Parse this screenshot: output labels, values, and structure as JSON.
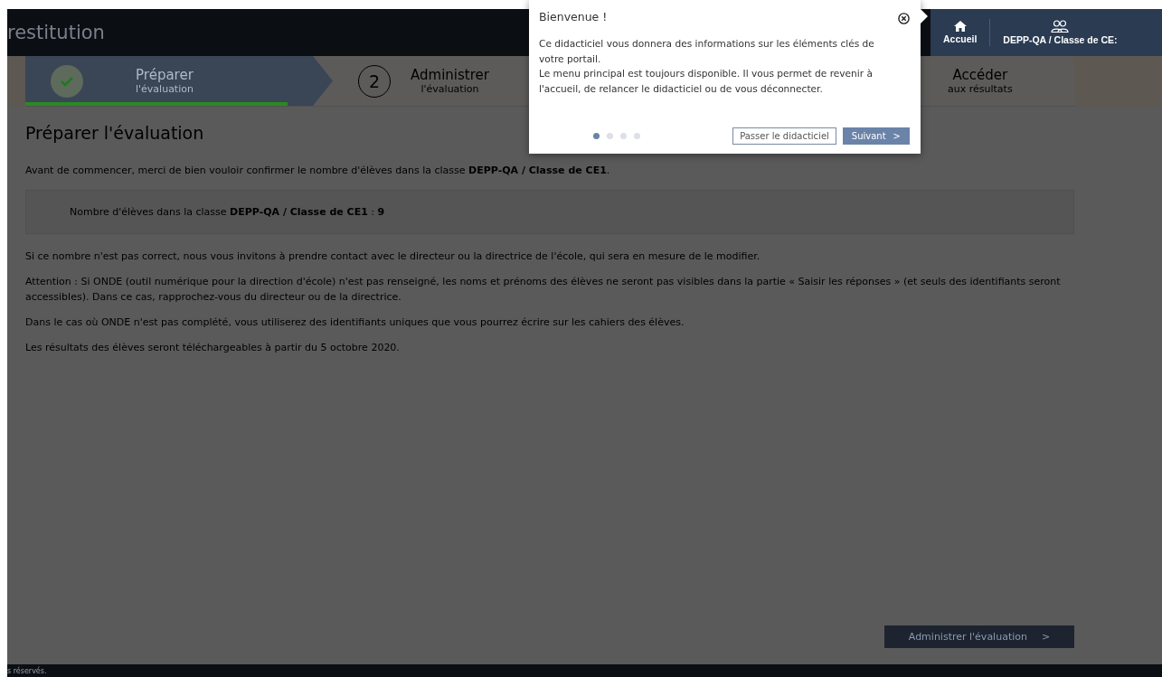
{
  "header": {
    "title": "restitution"
  },
  "nav": {
    "items": [
      {
        "kind": "home",
        "label": "Accueil"
      },
      {
        "kind": "class",
        "label": "DEPP-QA / Classe de CE:"
      }
    ]
  },
  "steps": [
    {
      "kind": "done",
      "title": "Préparer",
      "subtitle": "l'évaluation",
      "selected": true
    },
    {
      "kind": "number",
      "number": "2",
      "title": "Administrer",
      "subtitle": "l'évaluation",
      "selected": false
    },
    {
      "kind": "covered",
      "title": "Accéder",
      "subtitle": "aux résultats",
      "selected": false
    }
  ],
  "page": {
    "title": "Préparer l'évaluation",
    "intro": "Avant de commencer, merci de bien vouloir confirmer le nombre d'élèves dans la classe **DEPP-QA / Classe de CE1**.",
    "count_box": "Nombre d'élèves dans la classe **DEPP-QA / Classe de CE1** : **9**",
    "paragraphs": [
      "Si ce nombre n'est pas correct, nous vous invitons à prendre contact avec le directeur ou la directrice de l'école, qui sera en mesure de le modifier.",
      "Attention : Si ONDE (outil numérique pour la direction d'école) n'est pas renseigné, les noms et prénoms des élèves ne seront pas visibles dans la partie « Saisir les réponses » (et seuls des identifiants seront accessibles). Dans ce cas, rapprochez-vous du directeur ou de la directrice.",
      "Dans le cas où ONDE n'est pas complété, vous utiliserez des identifiants uniques que vous pourrez écrire sur les cahiers des élèves.",
      "Les résultats des élèves seront téléchargeables à partir du 5 octobre 2020."
    ],
    "next_button": "Administrer l'évaluation",
    "next_chevron": ">"
  },
  "footer": {
    "text": "s réservés."
  },
  "tour": {
    "title": "Bienvenue !",
    "lines": [
      "Ce didacticiel vous donnera des informations sur les éléments clés de votre portail.",
      "Le menu principal est toujours disponible. Il vous permet de revenir à l'accueil, de relancer le didacticiel ou de vous déconnecter."
    ],
    "dots": [
      {
        "selected": true
      },
      {
        "selected": false
      },
      {
        "selected": false
      },
      {
        "selected": false
      }
    ],
    "skip_button": "Passer le didacticiel",
    "next_button": "Suivant",
    "next_chevron": ">"
  }
}
